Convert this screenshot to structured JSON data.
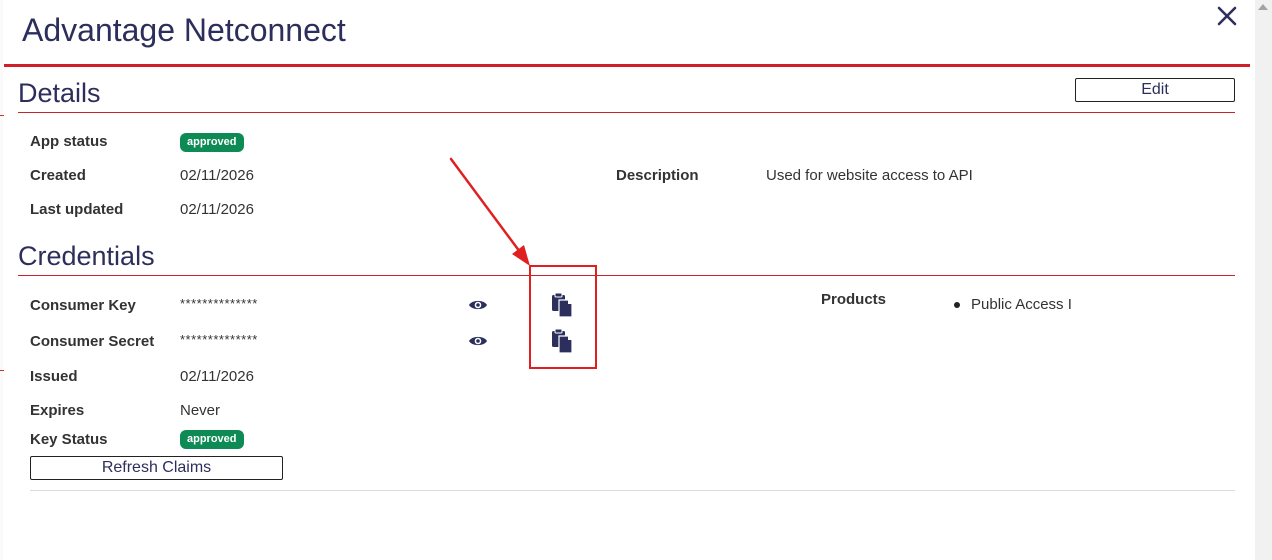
{
  "modal": {
    "title": "Advantage Netconnect",
    "close_icon": "close-icon"
  },
  "details": {
    "heading": "Details",
    "edit_label": "Edit",
    "app_status_label": "App status",
    "app_status_value": "approved",
    "created_label": "Created",
    "created_value": "02/11/2026",
    "last_updated_label": "Last updated",
    "last_updated_value": "02/11/2026",
    "description_label": "Description",
    "description_value": "Used for website access to API"
  },
  "credentials": {
    "heading": "Credentials",
    "consumer_key_label": "Consumer Key",
    "consumer_key_value": "**************",
    "consumer_secret_label": "Consumer Secret",
    "consumer_secret_value": "**************",
    "issued_label": "Issued",
    "issued_value": "02/11/2026",
    "expires_label": "Expires",
    "expires_value": "Never",
    "key_status_label": "Key Status",
    "key_status_value": "approved",
    "refresh_label": "Refresh Claims",
    "products_label": "Products",
    "products": [
      "Public Access I"
    ]
  },
  "colors": {
    "heading": "#2c2f5b",
    "rule": "#d11f2a",
    "badge": "#0e8b55",
    "annotation": "#e02020"
  },
  "icons": {
    "show": "eye-icon",
    "copy": "copy-clipboard-icon"
  }
}
